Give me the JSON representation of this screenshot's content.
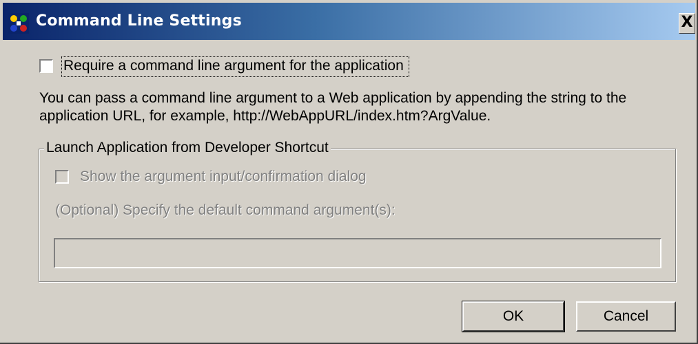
{
  "window": {
    "title": "Command Line Settings",
    "close_label": "X"
  },
  "require_argument": {
    "label": "Require a command line argument for the application",
    "checked": false
  },
  "description": "You can pass a command line argument to a Web application by appending the string to the application URL, for example, http://WebAppURL/index.htm?ArgValue.",
  "launch_group": {
    "title": "Launch Application from Developer Shortcut",
    "show_dialog_label": "Show the argument input/confirmation dialog",
    "default_args_label": "(Optional) Specify the default command argument(s):",
    "default_args_value": ""
  },
  "buttons": {
    "ok": "OK",
    "cancel": "Cancel"
  },
  "colors": {
    "dialog_bg": "#d4d0c8",
    "titlebar_start": "#0a246a",
    "titlebar_end": "#a6caf0",
    "disabled_text": "#808080"
  },
  "icons": {
    "title": "application-settings-icon",
    "close": "close-icon"
  }
}
